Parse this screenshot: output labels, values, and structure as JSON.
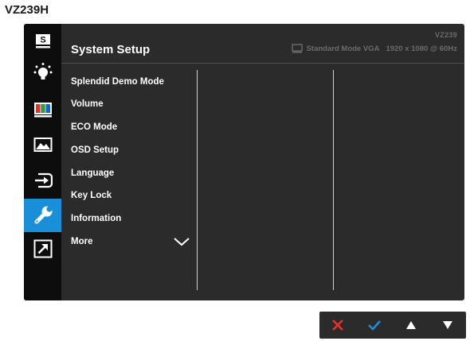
{
  "model_label": "VZ239H",
  "header": {
    "title": "System Setup",
    "model": "VZ239",
    "mode": "Standard Mode VGA",
    "resolution": "1920 x 1080 @ 60Hz"
  },
  "sidebar": {
    "items": [
      {
        "name": "splendid",
        "icon": "splendid-s-icon",
        "label": "S",
        "active": false
      },
      {
        "name": "blue-light-filter",
        "icon": "bulb-icon",
        "active": false
      },
      {
        "name": "color",
        "icon": "color-bars-icon",
        "active": false
      },
      {
        "name": "image",
        "icon": "image-icon",
        "active": false
      },
      {
        "name": "input-select",
        "icon": "input-select-icon",
        "active": false
      },
      {
        "name": "system-setup",
        "icon": "wrench-icon",
        "active": true
      },
      {
        "name": "shortcut",
        "icon": "shortcut-arrow-icon",
        "active": false
      }
    ]
  },
  "menu": {
    "items": [
      "Splendid Demo Mode",
      "Volume",
      "ECO Mode",
      "OSD Setup",
      "Language",
      "Key Lock",
      "Information",
      "More"
    ]
  },
  "nav_buttons": [
    {
      "name": "close",
      "icon": "close-x-icon",
      "color": "#e8302a"
    },
    {
      "name": "confirm",
      "icon": "checkmark-icon",
      "color": "#1a8fd9"
    },
    {
      "name": "up",
      "icon": "triangle-up-icon",
      "color": "#ffffff"
    },
    {
      "name": "down",
      "icon": "triangle-down-icon",
      "color": "#ffffff"
    }
  ],
  "colors": {
    "panel_bg": "#2b2b2b",
    "sidebar_bg": "#0d0d0d",
    "accent": "#1a8fd9",
    "close_red": "#e8302a",
    "header_gray": "#6b6b6b"
  }
}
